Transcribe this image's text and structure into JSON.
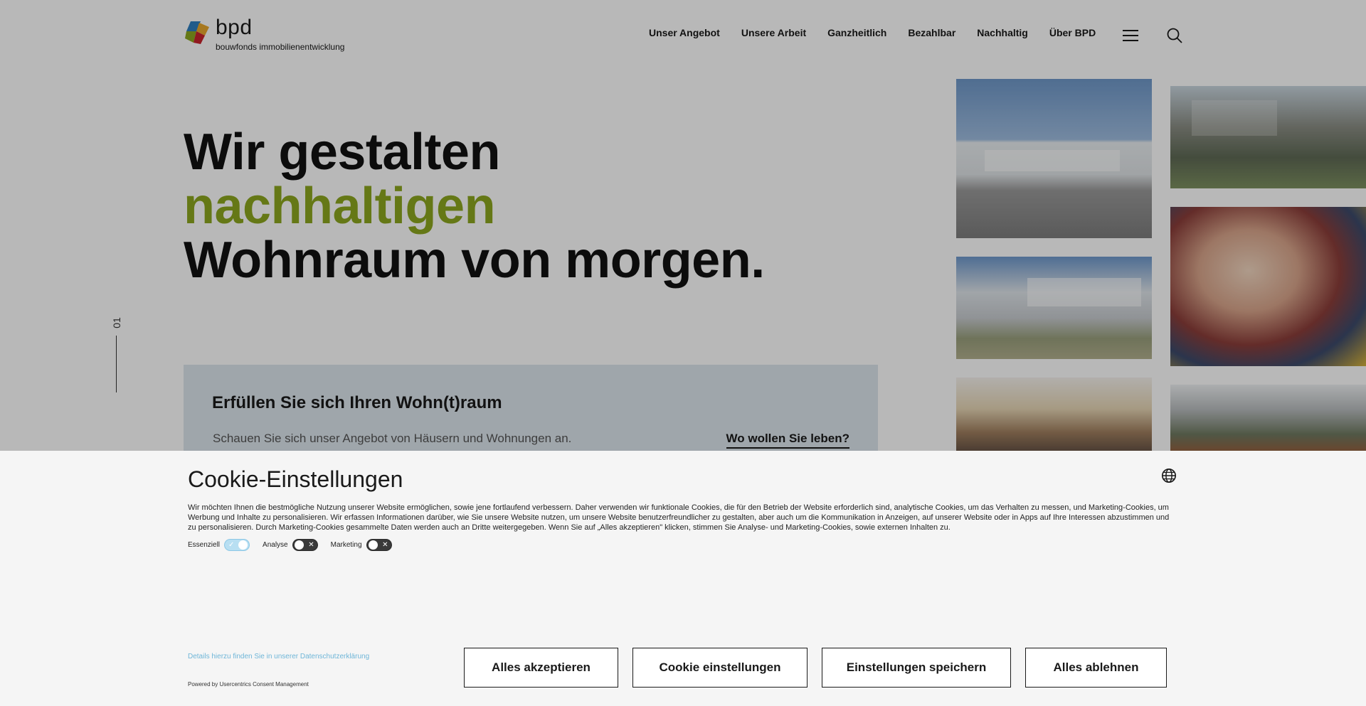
{
  "header": {
    "logo_word": "bpd",
    "logo_sub": "bouwfonds immobilienentwicklung",
    "nav": [
      "Unser Angebot",
      "Unsere Arbeit",
      "Ganzheitlich",
      "Bezahlbar",
      "Nachhaltig",
      "Über BPD"
    ]
  },
  "hero": {
    "line1": "Wir gestalten",
    "line2": "nachhaltigen",
    "line3": "Wohnraum von morgen.",
    "slide_number": "01"
  },
  "cta": {
    "title": "Erfüllen Sie sich Ihren Wohn(t)raum",
    "text": "Schauen Sie sich unser Angebot von Häusern und Wohnungen an.",
    "link": "Wo wollen Sie leben?"
  },
  "colors": {
    "accent_green": "#8ca71f",
    "cta_bg": "#dde6ee",
    "link_blue": "#6fb6d8"
  },
  "cookie": {
    "title": "Cookie-Einstellungen",
    "text": "Wir möchten Ihnen die bestmögliche Nutzung unserer Website ermöglichen, sowie jene fortlaufend verbessern. Daher verwenden wir funktionale Cookies, die für den Betrieb der Website erforderlich sind, analytische Cookies, um das Verhalten zu messen, und Marketing-Cookies, um Werbung und Inhalte zu personalisieren. Wir erfassen Informationen darüber, wie Sie unsere Website nutzen, um unsere Website benutzerfreundlicher zu gestalten, aber auch um die Kommunikation in Anzeigen, auf unserer Website oder in Apps auf Ihre Interessen abzustimmen und zu personalisieren. Durch Marketing-Cookies gesammelte Daten werden auch an Dritte weitergegeben. Wenn Sie auf „Alles akzeptieren\" klicken, stimmen Sie Analyse- und Marketing-Cookies, sowie externen Inhalten zu.",
    "toggles": [
      {
        "label": "Essenziell",
        "state": "on"
      },
      {
        "label": "Analyse",
        "state": "off"
      },
      {
        "label": "Marketing",
        "state": "off"
      }
    ],
    "details_link": "Details hierzu finden Sie in unserer Datenschutzerklärung",
    "powered": "Powered by Usercentrics Consent Management",
    "buttons": {
      "accept": "Alles akzeptieren",
      "settings": "Cookie einstellungen",
      "save": "Einstellungen speichern",
      "reject": "Alles ablehnen"
    }
  }
}
